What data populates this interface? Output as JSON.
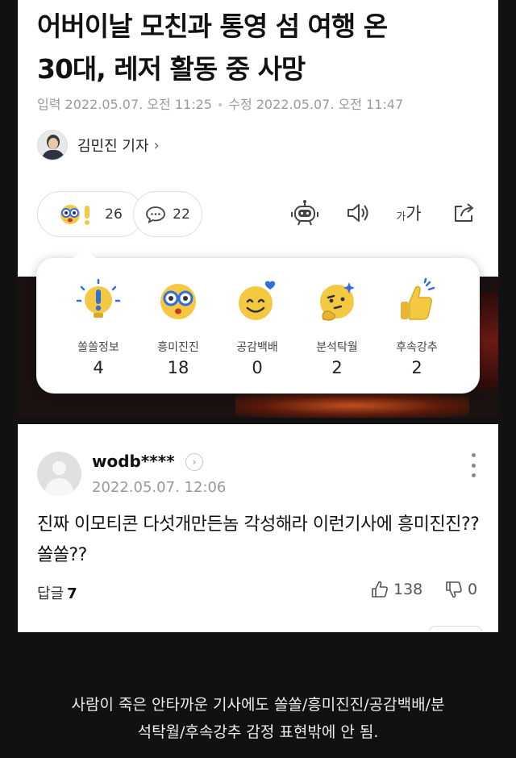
{
  "article": {
    "headline_line1": "어버이날 모친과 통영 섬 여행 온",
    "headline_line2": "30대, 레저 활동 중 사망",
    "published": "입력 2022.05.07. 오전 11:25",
    "modified": "수정 2022.05.07. 오전 11:47",
    "meta_separator": "•",
    "author": "김민진 기자",
    "author_chevron": "›"
  },
  "toolbar": {
    "reaction_count": "26",
    "comment_count": "22",
    "font_small": "가",
    "font_large": "가"
  },
  "reactions": [
    {
      "label": "쏠쏠정보",
      "count": "4",
      "icon": "lightbulb-icon"
    },
    {
      "label": "흥미진진",
      "count": "18",
      "icon": "glasses-face-icon"
    },
    {
      "label": "공감백배",
      "count": "0",
      "icon": "heart-smile-icon"
    },
    {
      "label": "분석탁월",
      "count": "2",
      "icon": "thinking-face-icon"
    },
    {
      "label": "후속강추",
      "count": "2",
      "icon": "thumbs-up-icon"
    }
  ],
  "comment": {
    "user": "wodb****",
    "date": "2022.05.07. 12:06",
    "body": "진짜 이모티콘 다섯개만든놈 각성해라 이런기사에 흥미진진?? 쏠쏠??",
    "replies_label": "답글",
    "replies_count": "7",
    "likes": "138",
    "dislikes": "0"
  },
  "caption": {
    "line1": "사람이 죽은 안타까운 기사에도 쏠쏠/흥미진진/공감백배/분",
    "line2": "석탁월/후속강추 감정 표현밖에 안 됨."
  },
  "colors": {
    "emoji_yellow": "#f5c842",
    "accent_blue": "#2f6fe0",
    "background_dark": "#111111"
  }
}
